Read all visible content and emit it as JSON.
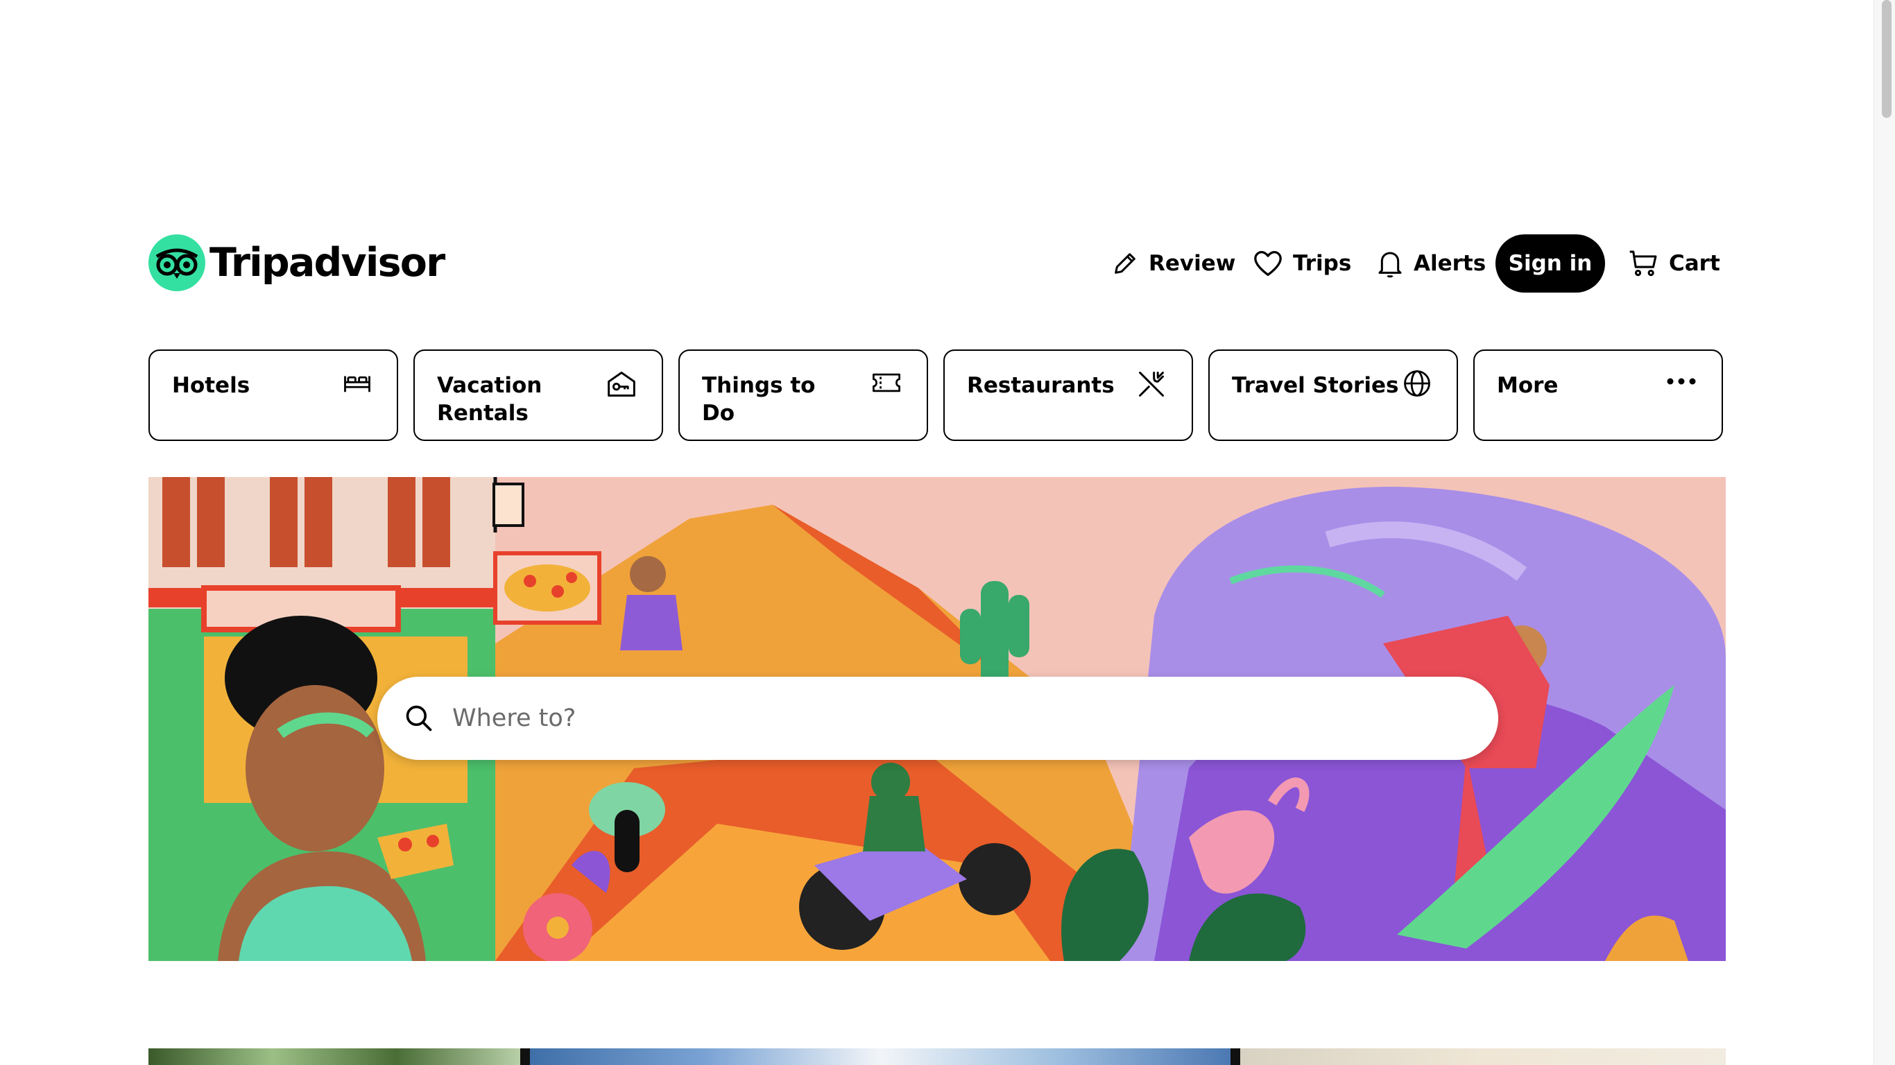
{
  "brand": {
    "name": "Tripadvisor",
    "logo_color": "#34e0a1"
  },
  "header": {
    "review_label": "Review",
    "trips_label": "Trips",
    "alerts_label": "Alerts",
    "signin_label": "Sign in",
    "cart_label": "Cart"
  },
  "categories": [
    {
      "label": "Hotels",
      "icon": "bed-icon"
    },
    {
      "label": "Vacation Rentals",
      "icon": "house-key-icon"
    },
    {
      "label": "Things to Do",
      "icon": "ticket-icon"
    },
    {
      "label": "Restaurants",
      "icon": "fork-knife-icon"
    },
    {
      "label": "Travel Stories",
      "icon": "globe-icon"
    },
    {
      "label": "More",
      "icon": "more-dots-icon"
    }
  ],
  "search": {
    "placeholder": "Where to?",
    "value": ""
  },
  "colors": {
    "text": "#000000",
    "signin_bg": "#000000",
    "signin_text": "#ffffff",
    "border": "#000000"
  }
}
